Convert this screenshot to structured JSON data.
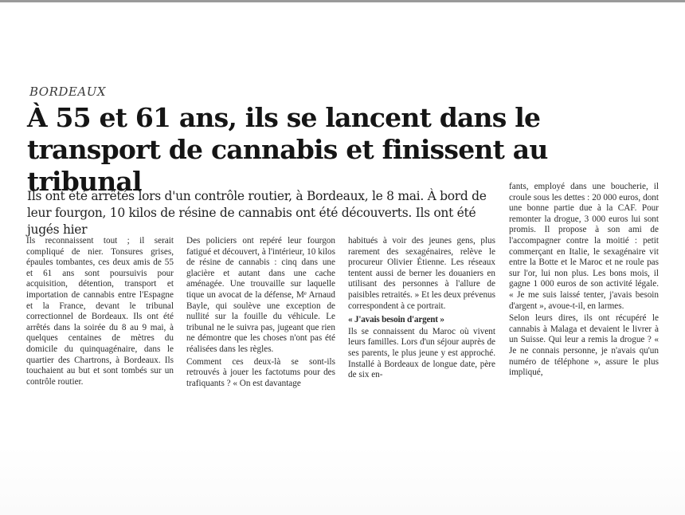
{
  "article": {
    "kicker": "BORDEAUX",
    "headline": "À 55 et 61 ans, ils se lancent dans le transport de cannabis et finissent au tribunal",
    "standfirst": "Ils ont été arrêtés lors d'un contrôle routier, à Bordeaux, le 8 mai. À bord de leur fourgon, 10 kilos de résine de cannabis ont été découverts. Ils ont été jugés hier",
    "columns": {
      "col1": {
        "p1": "Ils reconnaissent tout ; il serait compliqué de nier. Tonsures grises, épaules tombantes, ces deux amis de 55 et 61 ans sont poursuivis pour acquisition, détention, transport et importation de cannabis entre l'Espagne et la France, devant le tribunal correctionnel de Bordeaux. Ils ont été arrêtés dans la soirée du 8 au 9 mai, à quelques centaines de mètres du domicile du quinquagénaire, dans le quartier des Chartrons, à Bordeaux. Ils touchaient au but et sont tombés sur un contrôle routier."
      },
      "col2": {
        "p1": "Des policiers ont repéré leur fourgon fatigué et découvert, à l'intérieur, 10 kilos de résine de cannabis : cinq dans une glacière et autant dans une cache aménagée. Une trouvaille sur laquelle tique un avocat de la défense, Mᵉ Arnaud Bayle, qui soulève une exception de nullité sur la fouille du véhicule. Le tribunal ne le suivra pas, jugeant que rien ne démontre que les choses n'ont pas été réalisées dans les règles.",
        "p2": "Comment ces deux-là se sont-ils retrouvés à jouer les factotums pour des trafiquants ? « On est davantage"
      },
      "col3": {
        "p1": "habitués à voir des jeunes gens, plus rarement des sexagénaires, relève le procureur Olivier Étienne. Les réseaux tentent aussi de berner les douaniers en utilisant des personnes à l'allure de paisibles retraités. » Et les deux prévenus correspondent à ce portrait.",
        "subhead": "« J'avais besoin d'argent »",
        "p2": "Ils se connaissent du Maroc où vivent leurs familles. Lors d'un séjour auprès de ses parents, le plus jeune y est approché. Installé à Bordeaux de longue date, père de six en-"
      },
      "col4": {
        "p1": "fants, employé dans une boucherie, il croule sous les dettes : 20 000 euros, dont une bonne partie due à la CAF. Pour remonter la drogue, 3 000 euros lui sont promis. Il propose à son ami de l'accompagner contre la moitié : petit commerçant en Italie, le sexagénaire vit entre la Botte et le Maroc et ne roule pas sur l'or, lui non plus. Les bons mois, il gagne 1 000 euros de son activité légale. « Je me suis laissé tenter, j'avais besoin d'argent », avoue-t-il, en larmes.",
        "p2": "Selon leurs dires, ils ont récupéré le cannabis à Malaga et devaient le livrer à un Suisse. Qui leur a remis la drogue ? « Je ne connais personne, je n'avais qu'un numéro de téléphone », assure le plus impliqué,"
      }
    }
  }
}
